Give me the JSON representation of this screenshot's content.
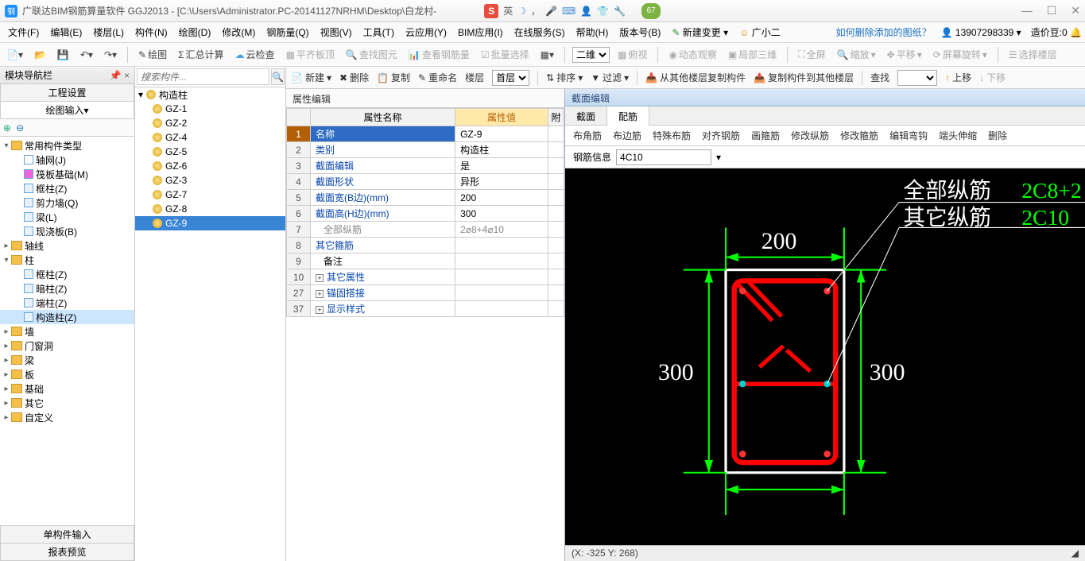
{
  "title": "广联达BIM钢筋算量软件 GGJ2013 - [C:\\Users\\Administrator.PC-20141127NRHM\\Desktop\\白龙村-",
  "ime": {
    "badge": "S",
    "lang": "英"
  },
  "bubble": "67",
  "menus": [
    "文件(F)",
    "编辑(E)",
    "楼层(L)",
    "构件(N)",
    "绘图(D)",
    "修改(M)",
    "钢筋量(Q)",
    "视图(V)",
    "工具(T)",
    "云应用(Y)",
    "BIM应用(I)",
    "在线服务(S)",
    "帮助(H)",
    "版本号(B)"
  ],
  "menu_extra": {
    "newchange": "新建变更",
    "user": "广小二",
    "tip": "如何删除添加的图纸？",
    "phone": "13907298339",
    "coin": "造价豆:0"
  },
  "tb1": {
    "draw": "绘图",
    "sum": "汇总计算",
    "cloud": "云检查",
    "flat": "平齐板顶",
    "findg": "查找图元",
    "viewbar": "查看钢筋量",
    "batch": "批量选择",
    "view2d": "二维",
    "over": "俯视",
    "dyn": "动态观察",
    "local3d": "局部三维",
    "full": "全屏",
    "zoom": "缩放",
    "pan": "平移",
    "rot": "屏幕旋转",
    "selfloor": "选择楼层"
  },
  "leftpane": {
    "title": "模块导航栏",
    "tab1": "工程设置",
    "tab2": "绘图输入",
    "tab3": "单构件输入",
    "tab4": "报表预览"
  },
  "tree": {
    "root": "常用构件类型",
    "c": [
      {
        "t": "轴网(J)"
      },
      {
        "t": "筏板基础(M)"
      },
      {
        "t": "框柱(Z)"
      },
      {
        "t": "剪力墙(Q)"
      },
      {
        "t": "梁(L)"
      },
      {
        "t": "现浇板(B)"
      }
    ],
    "axis": "轴线",
    "col": "柱",
    "cols": [
      {
        "t": "框柱(Z)"
      },
      {
        "t": "暗柱(Z)"
      },
      {
        "t": "端柱(Z)"
      },
      {
        "t": "构造柱(Z)",
        "sel": true
      }
    ],
    "rest": [
      "墙",
      "门窗洞",
      "梁",
      "板",
      "基础",
      "其它",
      "自定义"
    ]
  },
  "midtb": {
    "new": "新建",
    "del": "删除",
    "copy": "复制",
    "rename": "重命名",
    "floor": "楼层",
    "first": "首层",
    "sort": "排序",
    "filter": "过滤",
    "copyfrom": "从其他楼层复制构件",
    "copyto": "复制构件到其他楼层",
    "find": "查找",
    "up": "上移",
    "down": "下移"
  },
  "search_ph": "搜索构件...",
  "gz": {
    "root": "构造柱",
    "items": [
      "GZ-1",
      "GZ-2",
      "GZ-4",
      "GZ-5",
      "GZ-6",
      "GZ-3",
      "GZ-7",
      "GZ-8",
      "GZ-9"
    ],
    "sel": "GZ-9"
  },
  "prop": {
    "title": "属性编辑",
    "nameh": "属性名称",
    "valh": "属性值",
    "atth": "附",
    "rows": [
      {
        "n": "1",
        "name": "名称",
        "val": "GZ-9",
        "sel": true
      },
      {
        "n": "2",
        "name": "类别",
        "val": "构造柱"
      },
      {
        "n": "3",
        "name": "截面编辑",
        "val": "是"
      },
      {
        "n": "4",
        "name": "截面形状",
        "val": "异形"
      },
      {
        "n": "5",
        "name": "截面宽(B边)(mm)",
        "val": "200"
      },
      {
        "n": "6",
        "name": "截面高(H边)(mm)",
        "val": "300"
      },
      {
        "n": "7",
        "name": "全部纵筋",
        "val": "2⌀8+4⌀10",
        "grey": true
      },
      {
        "n": "8",
        "name": "其它箍筋",
        "val": ""
      },
      {
        "n": "9",
        "name": "备注",
        "val": ""
      },
      {
        "n": "10",
        "name": "其它属性",
        "exp": true
      },
      {
        "n": "27",
        "name": "锚固搭接",
        "exp": true
      },
      {
        "n": "37",
        "name": "显示样式",
        "exp": true
      }
    ]
  },
  "section": {
    "title": "截面编辑",
    "tab1": "截面",
    "tab2": "配筋",
    "actions": [
      "布角筋",
      "布边筋",
      "特殊布筋",
      "对齐钢筋",
      "画箍筋",
      "修改纵筋",
      "修改箍筋",
      "编辑弯钩",
      "端头伸缩",
      "删除"
    ],
    "infolbl": "钢筋信息",
    "infoval": "4C10",
    "labels": {
      "all": "全部纵筋",
      "other": "其它纵筋",
      "allv": "2C8+2",
      "otherv": "2C10"
    },
    "dims": {
      "w": "200",
      "h": "300"
    },
    "coord": "(X: -325 Y: 268)"
  }
}
